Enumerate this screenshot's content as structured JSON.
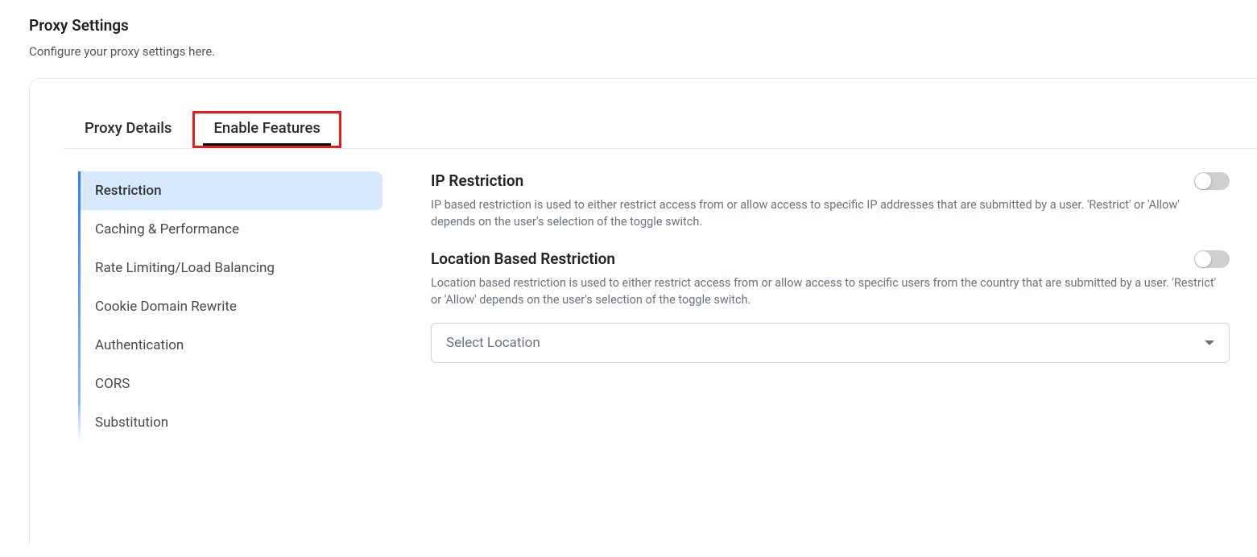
{
  "header": {
    "title": "Proxy Settings",
    "subtitle": "Configure your proxy settings here."
  },
  "tabs": [
    {
      "id": "proxy-details",
      "label": "Proxy Details",
      "active": false,
      "highlighted": false
    },
    {
      "id": "enable-features",
      "label": "Enable Features",
      "active": true,
      "highlighted": true
    }
  ],
  "sidebar": {
    "items": [
      {
        "id": "restriction",
        "label": "Restriction",
        "active": true
      },
      {
        "id": "caching-performance",
        "label": "Caching & Performance",
        "active": false
      },
      {
        "id": "rate-limiting-load-balancing",
        "label": "Rate Limiting/Load Balancing",
        "active": false
      },
      {
        "id": "cookie-domain-rewrite",
        "label": "Cookie Domain Rewrite",
        "active": false
      },
      {
        "id": "authentication",
        "label": "Authentication",
        "active": false
      },
      {
        "id": "cors",
        "label": "CORS",
        "active": false
      },
      {
        "id": "substitution",
        "label": "Substitution",
        "active": false
      }
    ]
  },
  "features": {
    "ip_restriction": {
      "title": "IP Restriction",
      "description": "IP based restriction is used to either restrict access from or allow access to specific IP addresses that are submitted by a user. 'Restrict' or 'Allow' depends on the user's selection of the toggle switch.",
      "enabled": false
    },
    "location_restriction": {
      "title": "Location Based Restriction",
      "description": "Location based restriction is used to either restrict access from or allow access to specific users from the country that are submitted by a user. 'Restrict' or 'Allow' depends on the user's selection of the toggle switch.",
      "enabled": false,
      "select_placeholder": "Select Location"
    }
  }
}
